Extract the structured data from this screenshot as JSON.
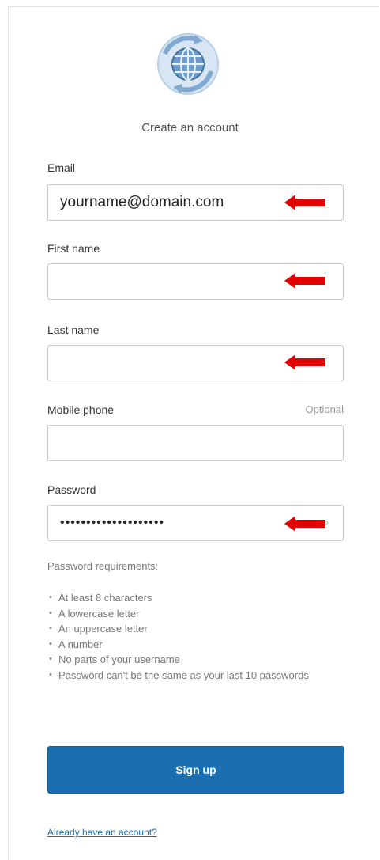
{
  "header": {
    "title": "Create an account"
  },
  "form": {
    "email": {
      "label": "Email",
      "value": "yourname@domain.com"
    },
    "first_name": {
      "label": "First name",
      "value": ""
    },
    "last_name": {
      "label": "Last name",
      "value": ""
    },
    "mobile_phone": {
      "label": "Mobile phone",
      "optional_label": "Optional",
      "value": ""
    },
    "password": {
      "label": "Password",
      "value": "••••••••••••••••••••"
    }
  },
  "requirements": {
    "title": "Password requirements:",
    "items": [
      "At least 8 characters",
      "A lowercase letter",
      "An uppercase letter",
      "A number",
      "No parts of your username",
      "Password can't be the same as your last 10 passwords"
    ]
  },
  "actions": {
    "signup_label": "Sign up",
    "signin_link": "Already have an account?"
  },
  "colors": {
    "primary": "#1b6fb0",
    "annotation_arrow": "#e30000",
    "logo_blue": "#5b92c3"
  },
  "icons": {
    "logo": "globe-with-cycle-arrows-icon",
    "annotation": "red-arrow-left-icon",
    "password_toggle": "eye-toggle-icon"
  }
}
